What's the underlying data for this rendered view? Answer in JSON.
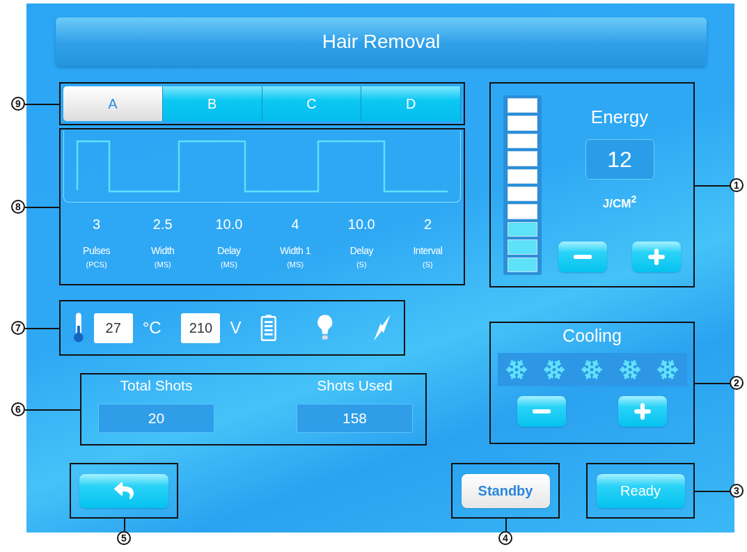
{
  "title": "Hair Removal",
  "modes": {
    "callout": "9",
    "tabs": [
      {
        "label": "A",
        "selected": true
      },
      {
        "label": "B",
        "selected": false
      },
      {
        "label": "C",
        "selected": false
      },
      {
        "label": "D",
        "selected": false
      }
    ]
  },
  "pulse": {
    "callout": "8",
    "params": [
      {
        "value": "3",
        "label": "Pulses",
        "unit": "(PCS)"
      },
      {
        "value": "2.5",
        "label": "Width",
        "unit": "(MS)"
      },
      {
        "value": "10.0",
        "label": "Delay",
        "unit": "(MS)"
      },
      {
        "value": "4",
        "label": "Width 1",
        "unit": "(MS)"
      },
      {
        "value": "10.0",
        "label": "Delay",
        "unit": "(S)"
      },
      {
        "value": "2",
        "label": "Interval",
        "unit": "(S)"
      }
    ]
  },
  "status": {
    "callout": "7",
    "temperature": {
      "value": "27",
      "unit": "°C"
    },
    "voltage": {
      "value": "210",
      "unit": "V"
    }
  },
  "shots": {
    "callout": "6",
    "items": [
      {
        "label": "Total Shots",
        "value": "20"
      },
      {
        "label": "Shots Used",
        "value": "158"
      }
    ]
  },
  "energy": {
    "callout": "1",
    "label": "Energy",
    "value": "12",
    "unit": "J/CM$^{2}$",
    "segments": [
      {
        "lit": false
      },
      {
        "lit": false
      },
      {
        "lit": false
      },
      {
        "lit": false
      },
      {
        "lit": false
      },
      {
        "lit": false
      },
      {
        "lit": false
      },
      {
        "lit": true
      },
      {
        "lit": true
      },
      {
        "lit": true
      }
    ]
  },
  "cooling": {
    "callout": "2",
    "label": "Cooling"
  },
  "back": {
    "callout": "5"
  },
  "actions": [
    {
      "label": "Standby",
      "selected": true,
      "callout": "4"
    },
    {
      "label": "Ready",
      "selected": false,
      "callout": "3"
    }
  ]
}
